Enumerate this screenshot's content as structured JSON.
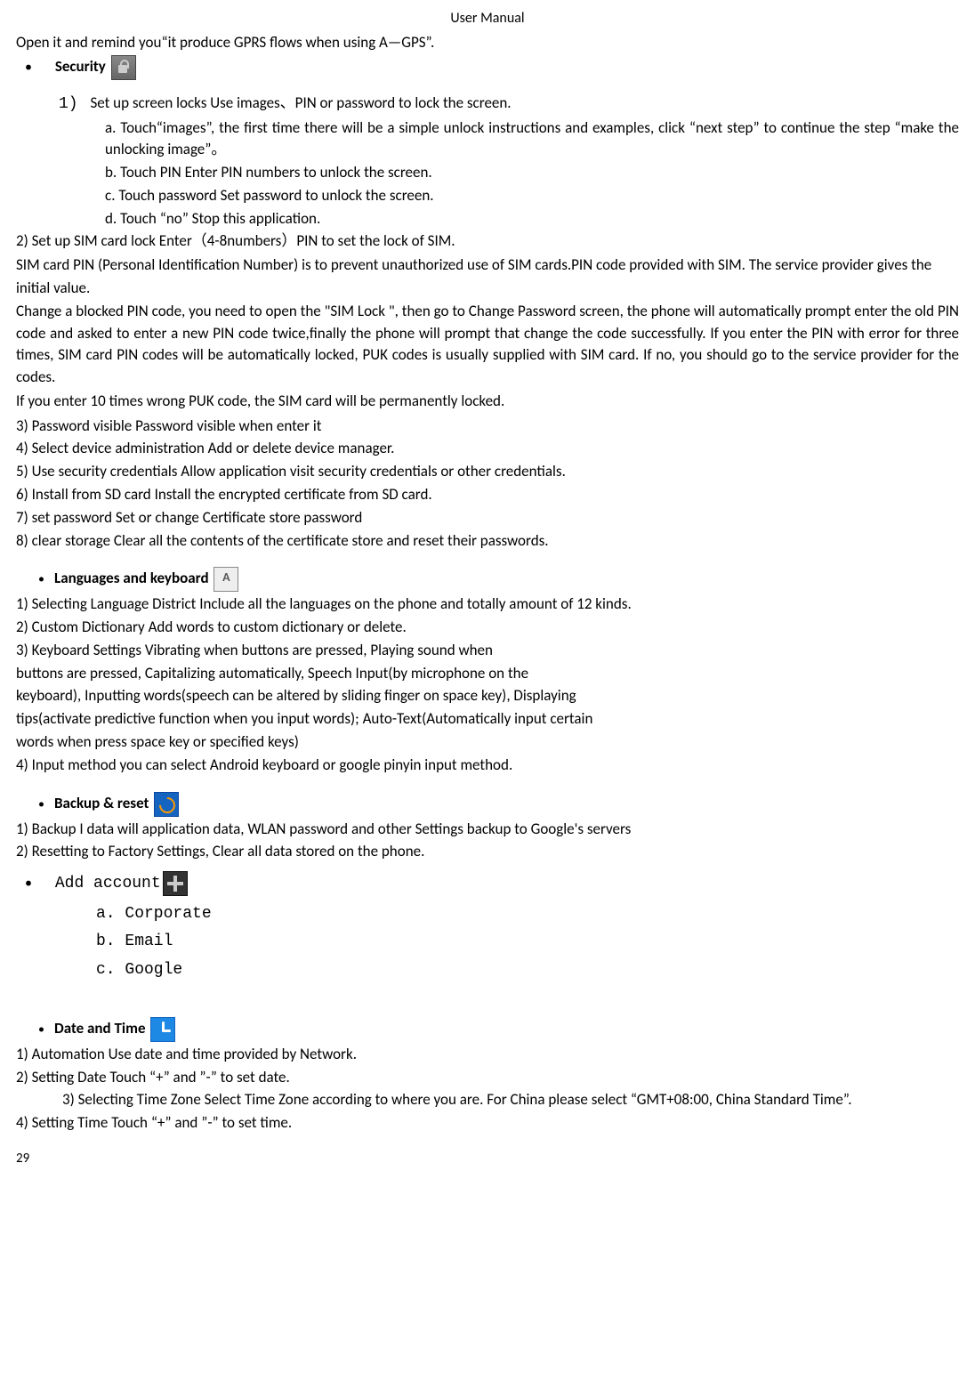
{
  "header": "User    Manual",
  "intro_line": "Open it and remind you“it produce GPRS flows when using A—GPS”.",
  "security": {
    "title": "Security",
    "item1_label": "1)",
    "item1": "Set up screen locks      Use images、PIN or password to lock the screen.",
    "item1a": "a. Touch“images”,    the first time there will be a simple unlock instructions and examples, click “next step” to continue the step “make the unlocking image”。",
    "item1b": "b. Touch PIN Enter PIN numbers to unlock the screen.",
    "item1c": "c. Touch password      Set password to unlock the screen.",
    "item1d": "d. Touch “no”     Stop this application.",
    "item2": "2)    Set up SIM card lock      Enter（4-8numbers）PIN to set the lock of SIM.",
    "sim_para1": "SIM card PIN (Personal Identification Number) is to prevent unauthorized use of SIM cards.PIN code provided with SIM. The service provider gives the initial value.",
    "sim_para2": "Change a blocked PIN code, you need to open the \"SIM Lock \", then go to Change Password screen, the phone will automatically prompt enter the old PIN code and asked to enter a new PIN code twice,finally the phone will prompt that change the code successfully. If you enter the PIN with error for three times, SIM card PIN codes will be automatically locked, PUK codes is usually supplied with SIM card. If no, you should go to the service provider for the codes.",
    "sim_para3": "If you enter 10 times wrong PUK code, the SIM card will be permanently locked.",
    "item3": "3)    Password visible        Password visible when enter it",
    "item4": "4)    Select device administration      Add or delete device manager.",
    "item5": "5)    Use security credentials        Allow application visit security credentials or other credentials.",
    "item6": "6)    Install from SD card      Install the encrypted certificate from SD card.",
    "item7": "7)    set password        Set or change Certificate store password",
    "item8": "8)    clear storage        Clear all the contents of the certificate store and reset their passwords."
  },
  "languages": {
    "title": "Languages and keyboard",
    "icon_letter": "A",
    "item1": "1) Selecting Language District        Include all the languages on the phone and totally amount of 12 kinds.",
    "item2": "2) Custom Dictionary          Add words to custom dictionary or delete.",
    "item3a": "3) Keyboard Settings        Vibrating when buttons are pressed, Playing sound when",
    "item3b": "buttons are pressed, Capitalizing automatically, Speech Input(by microphone on the",
    "item3c": "keyboard), Inputting words(speech can be altered by sliding finger on space key), Displaying",
    "item3d": "tips(activate predictive function when you input words); Auto-Text(Automatically input certain",
    "item3e": "words when press space key or specified keys)",
    "item4": "4) Input method        you can select Android keyboard or google pinyin input method."
  },
  "backup": {
    "title": "Backup & reset",
    "item1": "1)    Backup I data will application data, WLAN password and other Settings backup to Google's servers",
    "item2": "2)    Resetting to Factory Settings, Clear all data stored on the phone."
  },
  "add_account": {
    "title": "Add account",
    "a": "a.  Corporate",
    "b": "b.  Email",
    "c": "c.  Google"
  },
  "datetime": {
    "title": "Date and Time",
    "item1": "1) Automation        Use date and time provided by Network.",
    "item2": "2) Setting Date        Touch “+” and ”-” to set date.",
    "item3a": "3) Selecting Time Zone       Select Time Zone according to where you are. For China please select “GMT+08:00, China Standard Time”.",
    "item4": "4) Setting Time        Touch “+” and ”-” to set time."
  },
  "page_number": "29"
}
